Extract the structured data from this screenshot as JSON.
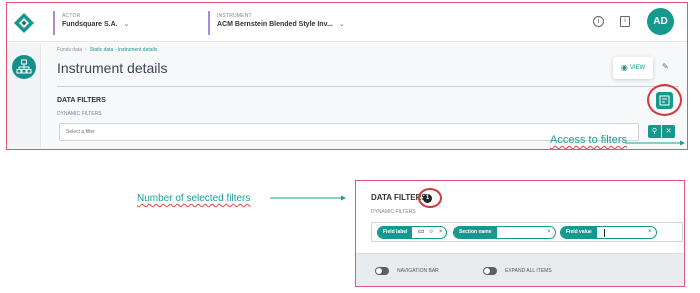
{
  "app": {
    "actor": {
      "caption": "ACTOR",
      "value": "Fundsquare S.A."
    },
    "instrument": {
      "caption": "INSTRUMENT",
      "value": "ACM Bernstein Blended Style Inv..."
    },
    "avatar_initials": "AD",
    "brand_color": "#15988e",
    "annotation_color": "#1d9e96",
    "highlight_color": "#d23a3a"
  },
  "breadcrumb": {
    "items": [
      "Funds data",
      "Static data - Instrument details"
    ]
  },
  "page": {
    "title": "Instrument details",
    "view_label": "VIEW"
  },
  "filters": {
    "title": "DATA FILTERS",
    "dynamic_label": "DYNAMIC FILTERS",
    "placeholder": "Select a filter"
  },
  "annotations": {
    "access_to_filters": "Access to filters",
    "number_of_selected_filters": "Number of selected filters"
  },
  "detail": {
    "title": "DATA FILTERS",
    "selected_count": "1",
    "dynamic_label": "DYNAMIC FILTERS",
    "chips": [
      {
        "label": "Field label",
        "value": "cci"
      },
      {
        "label": "Section name",
        "value": ""
      },
      {
        "label": "Field value",
        "value": ""
      }
    ],
    "navigation_bar_label": "NAVIGATION BAR",
    "expand_all_label": "EXPAND ALL ITEMS"
  },
  "icons": {
    "logo": "diamond-logo-icon",
    "info": "info-icon",
    "document": "document-icon",
    "nav": "hierarchy-icon",
    "view": "eye-icon",
    "edit": "pencil-icon",
    "filter_toggle": "filter-panel-icon",
    "search": "search-icon",
    "clear": "close-icon"
  }
}
